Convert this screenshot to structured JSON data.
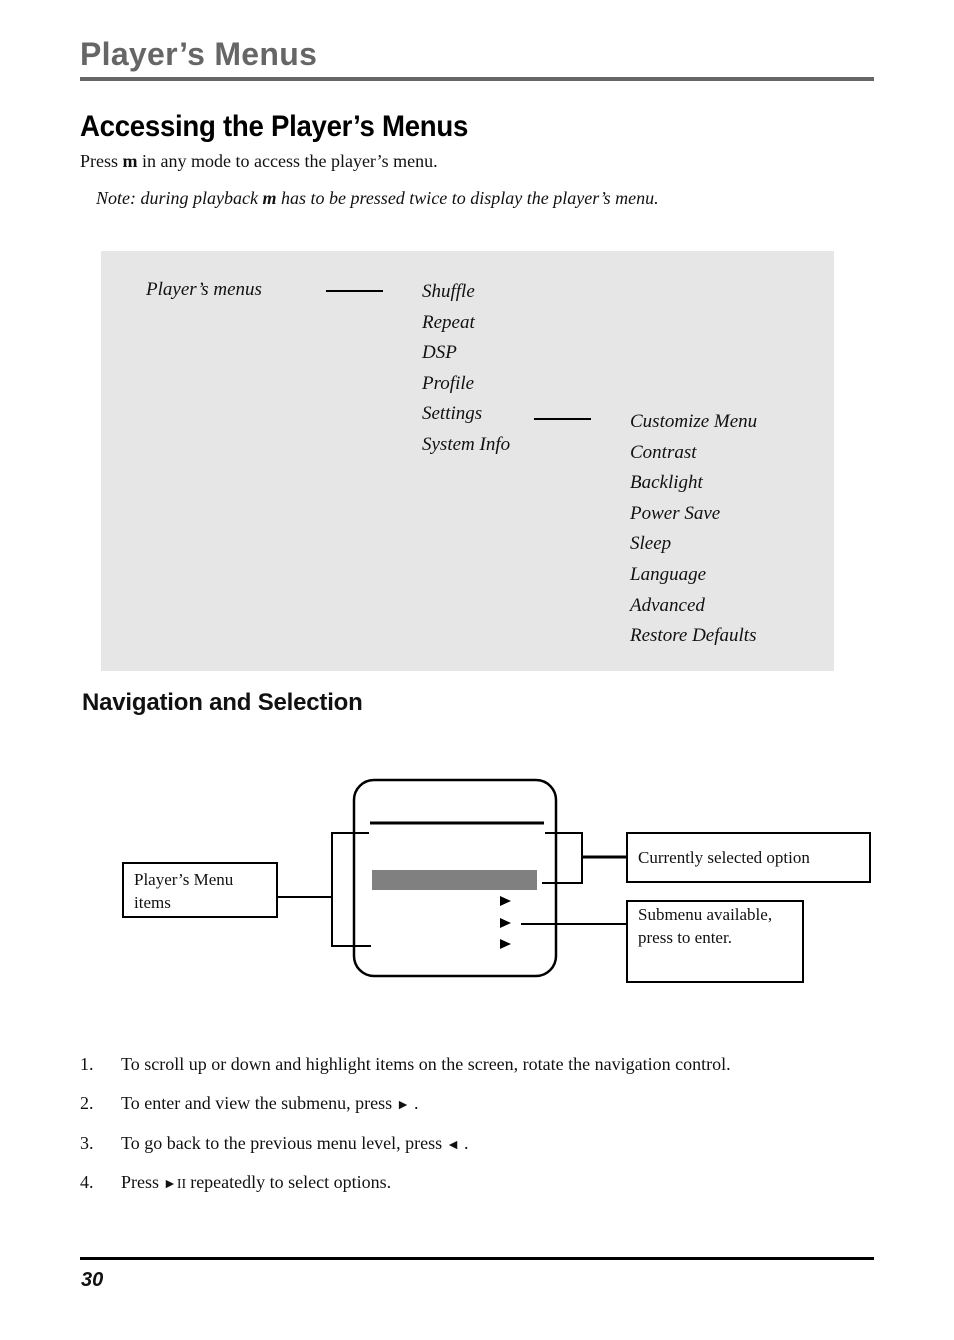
{
  "header": {
    "chapter_title": "Player’s Menus"
  },
  "section": {
    "title": "Accessing the Player’s Menus",
    "intro_before": "Press ",
    "intro_key": "m",
    "intro_after": " in any mode to access the player’s menu.",
    "note_before": "Note: during playback ",
    "note_key": "m",
    "note_after": " has to be pressed twice to display the player’s menu."
  },
  "menu_tree": {
    "root": "Player’s menus",
    "items": [
      "Shuffle",
      "Repeat",
      "DSP",
      "Profile",
      "Settings",
      "System Info"
    ],
    "settings_items": [
      "Customize Menu",
      "Contrast",
      "Backlight",
      "Power Save",
      "Sleep",
      "Language",
      "Advanced",
      "Restore Defaults"
    ],
    "panel_color": "#e6e6e6"
  },
  "navigation": {
    "title": "Navigation and Selection",
    "diagram": {
      "menu_items_label": "Player’s Menu items",
      "selected_label": "Currently selected option",
      "submenu_label": "Submenu available, press to enter.",
      "highlight_color": "#808080"
    },
    "steps": [
      {
        "num": "1.",
        "text": "To scroll up or down and highlight items on the screen, rotate the navigation control."
      },
      {
        "num": "2.",
        "text_before": "To enter and view the submenu, press",
        "glyph": "►",
        "text_after": "."
      },
      {
        "num": "3.",
        "text_before": "To go back to the previous menu level, press",
        "glyph": "◄",
        "text_after": "."
      },
      {
        "num": "4.",
        "text_before": "Press",
        "glyph": "►II",
        "text_after": "repeatedly to select options."
      }
    ]
  },
  "footer": {
    "page_number": "30"
  }
}
